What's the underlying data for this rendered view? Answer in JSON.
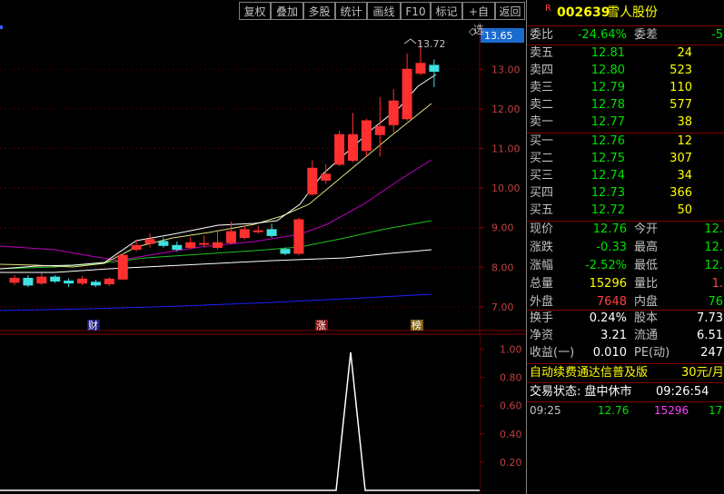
{
  "toolbar": {
    "buttons": [
      "复权",
      "叠加",
      "多股",
      "统计",
      "画线",
      "F10",
      "标记",
      "+自选",
      "返回"
    ]
  },
  "chart_main": {
    "current_price_tag": "13.65",
    "y_ticks": [
      "13.00",
      "12.00",
      "11.00",
      "10.00",
      "9.00",
      "8.00",
      "7.00"
    ],
    "high_annotation": "13.72",
    "markers": [
      "财",
      "涨",
      "榜"
    ]
  },
  "chart_indicator": {
    "y_ticks": [
      "1.00",
      "0.80",
      "0.60",
      "0.40",
      "0.20"
    ]
  },
  "chart_data": {
    "type": "candlestick",
    "ylim": [
      6.4,
      14.2
    ],
    "candles": [
      {
        "o": 7.62,
        "c": 7.72,
        "h": 7.8,
        "l": 7.55
      },
      {
        "o": 7.72,
        "c": 7.55,
        "h": 7.8,
        "l": 7.5
      },
      {
        "o": 7.6,
        "c": 7.75,
        "h": 7.85,
        "l": 7.55
      },
      {
        "o": 7.75,
        "c": 7.65,
        "h": 7.8,
        "l": 7.6
      },
      {
        "o": 7.65,
        "c": 7.6,
        "h": 7.72,
        "l": 7.5
      },
      {
        "o": 7.6,
        "c": 7.7,
        "h": 7.78,
        "l": 7.55
      },
      {
        "o": 7.62,
        "c": 7.55,
        "h": 7.68,
        "l": 7.5
      },
      {
        "o": 7.58,
        "c": 7.7,
        "h": 7.75,
        "l": 7.52
      },
      {
        "o": 7.7,
        "c": 8.3,
        "h": 8.35,
        "l": 7.68
      },
      {
        "o": 8.45,
        "c": 8.55,
        "h": 8.7,
        "l": 8.4
      },
      {
        "o": 8.6,
        "c": 8.7,
        "h": 8.85,
        "l": 8.5
      },
      {
        "o": 8.65,
        "c": 8.55,
        "h": 8.75,
        "l": 8.5
      },
      {
        "o": 8.55,
        "c": 8.45,
        "h": 8.65,
        "l": 8.4
      },
      {
        "o": 8.5,
        "c": 8.62,
        "h": 8.75,
        "l": 8.45
      },
      {
        "o": 8.6,
        "c": 8.6,
        "h": 8.8,
        "l": 8.5
      },
      {
        "o": 8.5,
        "c": 8.62,
        "h": 8.95,
        "l": 8.45
      },
      {
        "o": 8.62,
        "c": 8.9,
        "h": 9.15,
        "l": 8.58
      },
      {
        "o": 8.75,
        "c": 8.95,
        "h": 9.05,
        "l": 8.7
      },
      {
        "o": 8.9,
        "c": 8.92,
        "h": 9.05,
        "l": 8.85
      },
      {
        "o": 8.95,
        "c": 8.8,
        "h": 9.1,
        "l": 8.75
      },
      {
        "o": 8.45,
        "c": 8.35,
        "h": 8.5,
        "l": 8.3
      },
      {
        "o": 8.35,
        "c": 9.2,
        "h": 9.25,
        "l": 8.3
      },
      {
        "o": 9.85,
        "c": 10.5,
        "h": 10.7,
        "l": 9.8
      },
      {
        "o": 10.2,
        "c": 10.35,
        "h": 10.6,
        "l": 10.1
      },
      {
        "o": 10.6,
        "c": 11.35,
        "h": 11.45,
        "l": 10.55
      },
      {
        "o": 10.7,
        "c": 11.35,
        "h": 11.9,
        "l": 10.65
      },
      {
        "o": 10.95,
        "c": 11.7,
        "h": 11.75,
        "l": 10.8
      },
      {
        "o": 11.35,
        "c": 11.55,
        "h": 12.3,
        "l": 10.8
      },
      {
        "o": 11.6,
        "c": 12.2,
        "h": 12.5,
        "l": 11.4
      },
      {
        "o": 11.75,
        "c": 13.0,
        "h": 13.4,
        "l": 11.7
      },
      {
        "o": 12.9,
        "c": 13.15,
        "h": 13.72,
        "l": 12.85
      },
      {
        "o": 13.1,
        "c": 12.95,
        "h": 13.25,
        "l": 12.55
      }
    ]
  },
  "panel": {
    "code": "002639",
    "name": "雪人股份",
    "r_badge": "R",
    "weibi_label": "委比",
    "weibi_value": "-24.64%",
    "weicha_label": "委差",
    "weicha_value": "-5",
    "sells": [
      {
        "label": "卖五",
        "price": "12.81",
        "vol": "24"
      },
      {
        "label": "卖四",
        "price": "12.80",
        "vol": "523"
      },
      {
        "label": "卖三",
        "price": "12.79",
        "vol": "110"
      },
      {
        "label": "卖二",
        "price": "12.78",
        "vol": "577"
      },
      {
        "label": "卖一",
        "price": "12.77",
        "vol": "38"
      }
    ],
    "buys": [
      {
        "label": "买一",
        "price": "12.76",
        "vol": "12"
      },
      {
        "label": "买二",
        "price": "12.75",
        "vol": "307"
      },
      {
        "label": "买三",
        "price": "12.74",
        "vol": "34"
      },
      {
        "label": "买四",
        "price": "12.73",
        "vol": "366"
      },
      {
        "label": "买五",
        "price": "12.72",
        "vol": "50"
      }
    ],
    "quote": [
      {
        "l1": "现价",
        "v1": "12.76",
        "c1": "green",
        "l2": "今开",
        "v2": "12.",
        "c2": "green"
      },
      {
        "l1": "涨跌",
        "v1": "-0.33",
        "c1": "green",
        "l2": "最高",
        "v2": "12.",
        "c2": "green"
      },
      {
        "l1": "涨幅",
        "v1": "-2.52%",
        "c1": "green",
        "l2": "最低",
        "v2": "12.",
        "c2": "green"
      },
      {
        "l1": "总量",
        "v1": "15296",
        "c1": "yellow",
        "l2": "量比",
        "v2": "1.",
        "c2": "red"
      },
      {
        "l1": "外盘",
        "v1": "7648",
        "c1": "red",
        "l2": "内盘",
        "v2": "76",
        "c2": "green"
      }
    ],
    "fund": [
      {
        "l1": "换手",
        "v1": "0.24%",
        "l2": "股本",
        "v2": "7.73"
      },
      {
        "l1": "净资",
        "v1": "3.21",
        "l2": "流通",
        "v2": "6.51"
      },
      {
        "l1": "收益(一)",
        "v1": "0.010",
        "l2": "PE(动)",
        "v2": "247"
      }
    ],
    "promo_text": "自动续费通达信普及版",
    "promo_price": "30元/月",
    "status_text": "交易状态: 盘中休市",
    "status_time": "09:26:54",
    "tick": {
      "time": "09:25",
      "price": "12.76",
      "vol": "15296",
      "extra": "17"
    }
  }
}
